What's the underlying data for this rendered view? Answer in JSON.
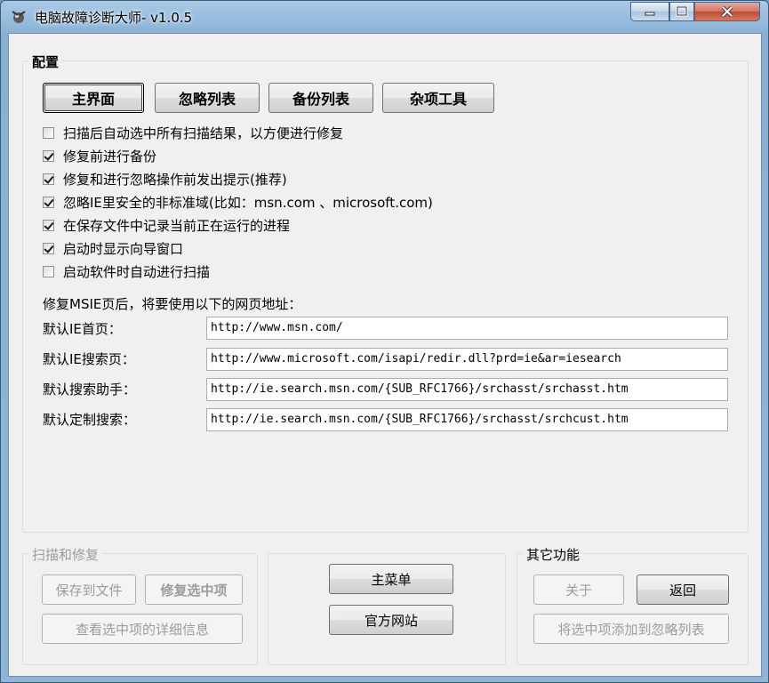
{
  "window": {
    "title": "电脑故障诊断大师- v1.0.5"
  },
  "config": {
    "legend": "配置",
    "tabs": [
      "主界面",
      "忽略列表",
      "备份列表",
      "杂项工具"
    ],
    "options": [
      {
        "label": "扫描后自动选中所有扫描结果，以方便进行修复",
        "checked": false
      },
      {
        "label": "修复前进行备份",
        "checked": true
      },
      {
        "label": "修复和进行忽略操作前发出提示(推荐)",
        "checked": true
      },
      {
        "label": "忽略IE里安全的非标准域(比如：msn.com 、microsoft.com)",
        "checked": true
      },
      {
        "label": "在保存文件中记录当前正在运行的进程",
        "checked": true
      },
      {
        "label": "启动时显示向导窗口",
        "checked": true
      },
      {
        "label": "启动软件时自动进行扫描",
        "checked": false
      }
    ],
    "urls_heading": "修复MSIE页后，将要使用以下的网页地址：",
    "urls": [
      {
        "label": "默认IE首页：",
        "value": "http://www.msn.com/"
      },
      {
        "label": "默认IE搜索页：",
        "value": "http://www.microsoft.com/isapi/redir.dll?prd=ie&ar=iesearch"
      },
      {
        "label": "默认搜索助手：",
        "value": "http://ie.search.msn.com/{SUB_RFC1766}/srchasst/srchasst.htm"
      },
      {
        "label": "默认定制搜索：",
        "value": "http://ie.search.msn.com/{SUB_RFC1766}/srchasst/srchcust.htm"
      }
    ]
  },
  "scan_group": {
    "legend": "扫描和修复",
    "save_file": "保存到文件",
    "fix_selected": "修复选中项",
    "view_details": "查看选中项的详细信息"
  },
  "center": {
    "main_menu": "主菜单",
    "official_site": "官方网站"
  },
  "other_group": {
    "legend": "其它功能",
    "about": "关于",
    "back": "返回",
    "add_to_ignore": "将选中项添加到忽略列表"
  }
}
